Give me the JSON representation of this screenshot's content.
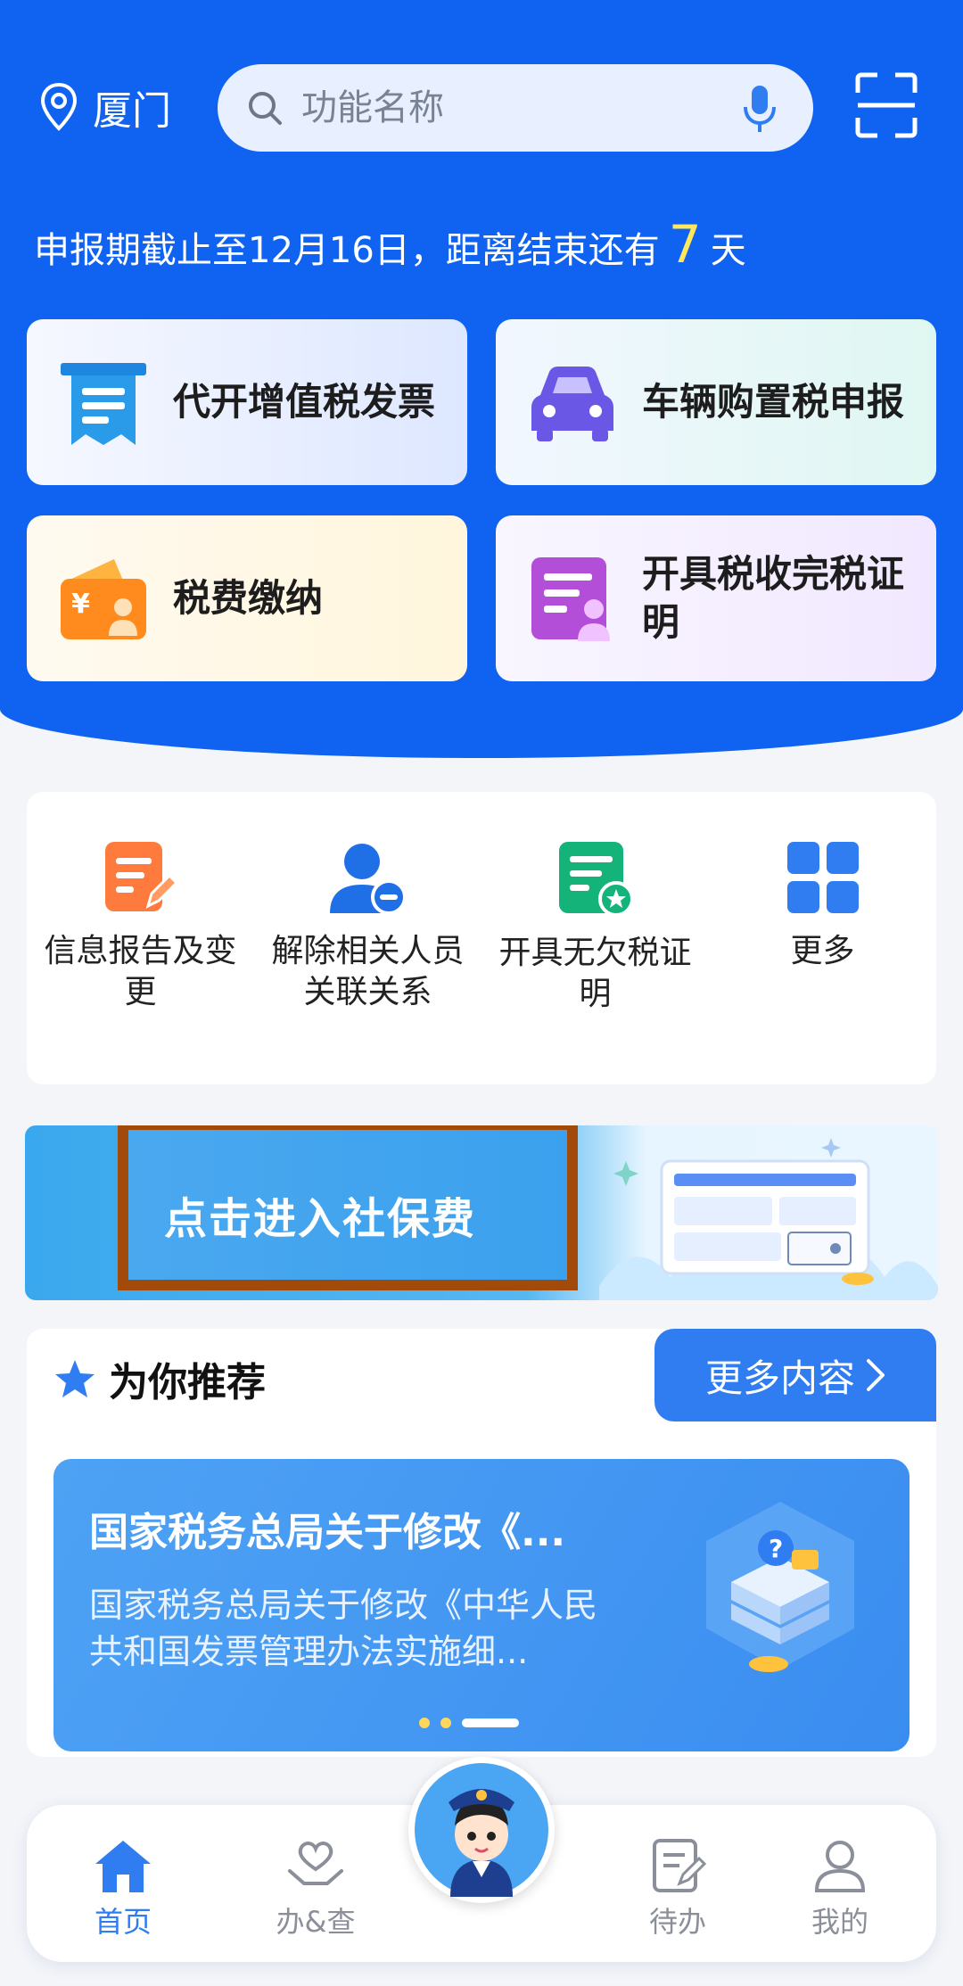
{
  "header": {
    "city": "厦门",
    "search_placeholder": "功能名称",
    "deadline_prefix": "申报期截止至12月16日，距离结束还有",
    "deadline_days": "7",
    "deadline_suffix": "天"
  },
  "quick_actions": [
    {
      "label": "代开增值税发票",
      "icon": "invoice-icon"
    },
    {
      "label": "车辆购置税申报",
      "icon": "car-icon"
    },
    {
      "label": "税费缴纳",
      "icon": "wallet-icon"
    },
    {
      "label": "开具税收完税证明",
      "icon": "certificate-icon"
    }
  ],
  "services": [
    {
      "label": "信息报告及变更",
      "icon": "report-edit-icon"
    },
    {
      "label": "解除相关人员关联关系",
      "icon": "user-remove-icon"
    },
    {
      "label": "开具无欠税证明",
      "icon": "certificate-star-icon"
    },
    {
      "label": "更多",
      "icon": "grid-icon"
    }
  ],
  "banner": {
    "text": "点击进入社保费"
  },
  "recommend": {
    "title": "为你推荐",
    "more": "更多内容",
    "article_title": "国家税务总局关于修改《...",
    "article_desc": "国家税务总局关于修改《中华人民共和国发票管理办法实施细..."
  },
  "tabbar": {
    "home": "首页",
    "service": "办&查",
    "todo": "待办",
    "mine": "我的"
  },
  "colors": {
    "brand_blue": "#0f63f0",
    "accent_yellow": "#ffe85c",
    "active_tab": "#2f7df1"
  }
}
